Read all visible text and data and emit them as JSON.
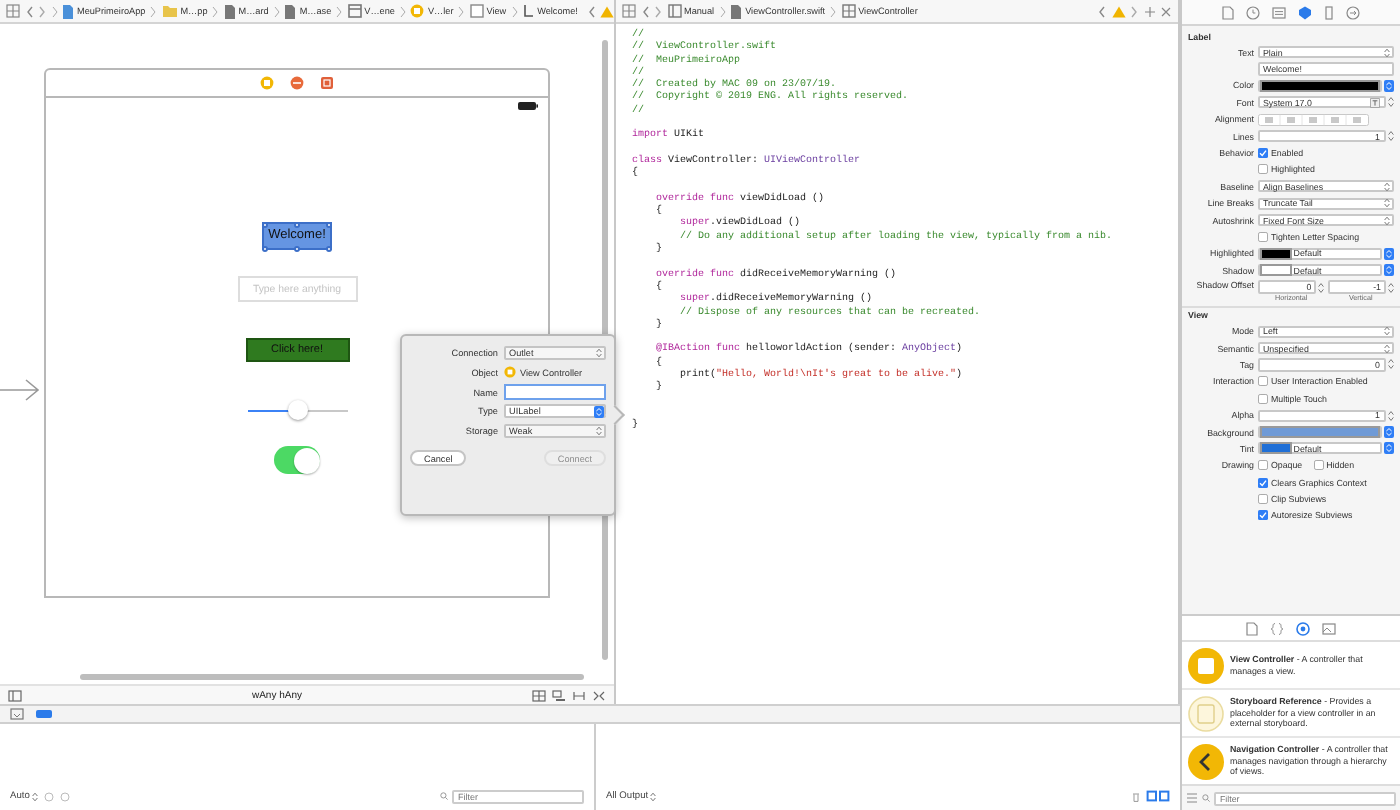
{
  "interface_builder": {
    "breadcrumb": [
      {
        "kind": "project",
        "text": "MeuPrimeiroApp"
      },
      {
        "kind": "folder",
        "text": "M…pp"
      },
      {
        "kind": "file",
        "text": "M…ard"
      },
      {
        "kind": "file",
        "text": "M…ase"
      },
      {
        "kind": "scene",
        "text": "V…ene"
      },
      {
        "kind": "controller",
        "text": "V…ler"
      },
      {
        "kind": "view",
        "text": "View"
      },
      {
        "kind": "label",
        "text": "Welcome!"
      }
    ],
    "canvas": {
      "label": {
        "text": "Welcome!",
        "selected": true
      },
      "text_field": {
        "placeholder": "Type here anything"
      },
      "button": {
        "label": "Click here!"
      },
      "slider": {
        "level": 0.5
      },
      "switch": {
        "on": true
      }
    },
    "size_class": "wAny hAny"
  },
  "code_editor": {
    "breadcrumb": [
      "Manual",
      "ViewController.swift",
      "ViewController"
    ],
    "lines": [
      {
        "kind": "code",
        "tokens": [
          {
            "kind": "comment",
            "text": "//"
          }
        ]
      },
      {
        "kind": "code",
        "tokens": [
          {
            "kind": "comment",
            "text": "//  ViewController.swift"
          }
        ]
      },
      {
        "kind": "code",
        "tokens": [
          {
            "kind": "comment",
            "text": "//  MeuPrimeiroApp"
          }
        ]
      },
      {
        "kind": "code",
        "tokens": [
          {
            "kind": "comment",
            "text": "//"
          }
        ]
      },
      {
        "kind": "code",
        "tokens": [
          {
            "kind": "comment",
            "text": "//  Created by MAC 09 on 23/07/19."
          }
        ]
      },
      {
        "kind": "code",
        "tokens": [
          {
            "kind": "comment",
            "text": "//  Copyright © 2019 ENG. All rights reserved."
          }
        ]
      },
      {
        "kind": "code",
        "tokens": [
          {
            "kind": "comment",
            "text": "//"
          }
        ]
      },
      {
        "kind": "blank"
      },
      {
        "kind": "code",
        "tokens": [
          {
            "kind": "keyword",
            "text": "import"
          },
          {
            "kind": "plain",
            "text": " UIKit"
          }
        ]
      },
      {
        "kind": "blank"
      },
      {
        "kind": "code",
        "tokens": [
          {
            "kind": "keyword",
            "text": "class"
          },
          {
            "kind": "plain",
            "text": " ViewController: "
          },
          {
            "kind": "type",
            "text": "UIViewController"
          }
        ]
      },
      {
        "kind": "code",
        "tokens": [
          {
            "kind": "plain",
            "text": "{"
          }
        ]
      },
      {
        "kind": "blank"
      },
      {
        "kind": "code",
        "tokens": [
          {
            "kind": "keyword",
            "text": "    override func"
          },
          {
            "kind": "plain",
            "text": " viewDidLoad ()"
          }
        ]
      },
      {
        "kind": "code",
        "tokens": [
          {
            "kind": "plain",
            "text": "    {"
          }
        ]
      },
      {
        "kind": "code",
        "tokens": [
          {
            "kind": "keyword",
            "text": "        super"
          },
          {
            "kind": "plain",
            "text": ".viewDidLoad ()"
          }
        ]
      },
      {
        "kind": "code",
        "tokens": [
          {
            "kind": "comment",
            "text": "        // Do any additional setup after loading the view, typically from a nib."
          }
        ]
      },
      {
        "kind": "code",
        "tokens": [
          {
            "kind": "plain",
            "text": "    }"
          }
        ]
      },
      {
        "kind": "blank"
      },
      {
        "kind": "code",
        "tokens": [
          {
            "kind": "keyword",
            "text": "    override func"
          },
          {
            "kind": "plain",
            "text": " didReceiveMemoryWarning ()"
          }
        ]
      },
      {
        "kind": "code",
        "tokens": [
          {
            "kind": "plain",
            "text": "    {"
          }
        ]
      },
      {
        "kind": "code",
        "tokens": [
          {
            "kind": "keyword",
            "text": "        super"
          },
          {
            "kind": "plain",
            "text": ".didReceiveMemoryWarning ()"
          }
        ]
      },
      {
        "kind": "code",
        "tokens": [
          {
            "kind": "comment",
            "text": "        // Dispose of any resources that can be recreated."
          }
        ]
      },
      {
        "kind": "code",
        "tokens": [
          {
            "kind": "plain",
            "text": "    }"
          }
        ]
      },
      {
        "kind": "blank"
      },
      {
        "kind": "code",
        "tokens": [
          {
            "kind": "keyword",
            "text": "    @IBAction func"
          },
          {
            "kind": "plain",
            "text": " helloworldAction (sender: "
          },
          {
            "kind": "type",
            "text": "AnyObject"
          },
          {
            "kind": "plain",
            "text": ")"
          }
        ]
      },
      {
        "kind": "code",
        "tokens": [
          {
            "kind": "plain",
            "text": "    {"
          }
        ]
      },
      {
        "kind": "code",
        "tokens": [
          {
            "kind": "plain",
            "text": "        print("
          },
          {
            "kind": "string",
            "text": "\"Hello, World!\\nIt's great to be alive.\""
          },
          {
            "kind": "plain",
            "text": ")"
          }
        ]
      },
      {
        "kind": "code",
        "tokens": [
          {
            "kind": "plain",
            "text": "    }"
          }
        ]
      },
      {
        "kind": "blank"
      },
      {
        "kind": "blank"
      },
      {
        "kind": "code",
        "tokens": [
          {
            "kind": "plain",
            "text": "}"
          }
        ]
      }
    ]
  },
  "connection_popover": {
    "rows": [
      {
        "kind": "select",
        "label": "Connection",
        "value": "Outlet"
      },
      {
        "kind": "object",
        "label": "Object",
        "value": "View Controller"
      },
      {
        "kind": "input",
        "label": "Name",
        "focused": true
      },
      {
        "kind": "combo",
        "label": "Type",
        "value": "UILabel"
      },
      {
        "kind": "select",
        "label": "Storage",
        "value": "Weak"
      }
    ],
    "buttons": [
      {
        "label": "Cancel",
        "disabled": false
      },
      {
        "label": "Connect",
        "disabled": true
      }
    ]
  },
  "debug_area": {
    "variables_scope": "Auto",
    "filter_placeholder": "Filter",
    "console_scope": "All Output"
  },
  "inspector": {
    "tabs": [
      {
        "kind": "file",
        "selected": false
      },
      {
        "kind": "help",
        "selected": false
      },
      {
        "kind": "identity",
        "selected": false
      },
      {
        "kind": "attributes",
        "selected": true
      },
      {
        "kind": "size",
        "selected": false
      },
      {
        "kind": "connections",
        "selected": false
      }
    ],
    "sections": [
      {
        "title": "Label",
        "rows": [
          {
            "kind": "select",
            "label": "Text",
            "value": "Plain"
          },
          {
            "kind": "field",
            "value": "Welcome!"
          },
          {
            "kind": "color",
            "label": "Color",
            "color": "#000000"
          },
          {
            "kind": "font",
            "label": "Font",
            "value": "System 17.0"
          },
          {
            "kind": "segmented",
            "label": "Alignment"
          },
          {
            "kind": "stepper",
            "label": "Lines",
            "value": "1"
          },
          {
            "kind": "checks",
            "label": "Behavior",
            "items": [
              {
                "label": "Enabled",
                "checked": true
              }
            ]
          },
          {
            "kind": "checks",
            "items": [
              {
                "label": "Highlighted",
                "checked": false
              }
            ]
          },
          {
            "kind": "select",
            "label": "Baseline",
            "value": "Align Baselines"
          },
          {
            "kind": "select",
            "label": "Line Breaks",
            "value": "Truncate Tail"
          },
          {
            "kind": "select",
            "label": "Autoshrink",
            "value": "Fixed Font Size"
          },
          {
            "kind": "checks",
            "items": [
              {
                "label": "Tighten Letter Spacing",
                "checked": false
              }
            ]
          },
          {
            "kind": "color",
            "label": "Highlighted",
            "color": "#000000",
            "value": "Default"
          },
          {
            "kind": "color",
            "label": "Shadow",
            "color": "#ffffff",
            "value": "Default"
          },
          {
            "kind": "offset",
            "label": "Shadow Offset",
            "fields": [
              {
                "value": "0",
                "caption": "Horizontal"
              },
              {
                "value": "-1",
                "caption": "Vertical"
              }
            ]
          }
        ]
      },
      {
        "title": "View",
        "rows": [
          {
            "kind": "select",
            "label": "Mode",
            "value": "Left"
          },
          {
            "kind": "select",
            "label": "Semantic",
            "value": "Unspecified"
          },
          {
            "kind": "stepper",
            "label": "Tag",
            "value": "0"
          },
          {
            "kind": "checks",
            "label": "Interaction",
            "items": [
              {
                "label": "User Interaction Enabled",
                "checked": false
              }
            ]
          },
          {
            "kind": "checks",
            "items": [
              {
                "label": "Multiple Touch",
                "checked": false
              }
            ]
          },
          {
            "kind": "stepper",
            "label": "Alpha",
            "value": "1"
          },
          {
            "kind": "color",
            "label": "Background",
            "color": "#6f9ad6"
          },
          {
            "kind": "color",
            "label": "Tint",
            "color": "#1f6fd6",
            "value": "Default"
          },
          {
            "kind": "checks",
            "label": "Drawing",
            "items": [
              {
                "label": "Opaque",
                "checked": false
              },
              {
                "label": "Hidden",
                "checked": false
              }
            ]
          },
          {
            "kind": "checks",
            "items": [
              {
                "label": "Clears Graphics Context",
                "checked": true
              }
            ]
          },
          {
            "kind": "checks",
            "items": [
              {
                "label": "Clip Subviews",
                "checked": false
              }
            ]
          },
          {
            "kind": "checks",
            "items": [
              {
                "label": "Autoresize Subviews",
                "checked": true
              }
            ]
          }
        ]
      }
    ]
  },
  "library": {
    "tabs": [
      {
        "kind": "file",
        "selected": false
      },
      {
        "kind": "braces",
        "selected": false
      },
      {
        "kind": "object",
        "selected": true
      },
      {
        "kind": "media",
        "selected": false
      }
    ],
    "items": [
      {
        "kind": "view-controller",
        "text": "**View Controller** - A controller that manages a view."
      },
      {
        "kind": "storyboard-reference",
        "text": "**Storyboard Reference** - Provides a placeholder for a view controller in an external storyboard."
      },
      {
        "kind": "navigation-controller",
        "text": "**Navigation Controller** - A controller that manages navigation through a hierarchy of views."
      }
    ],
    "filter_placeholder": "Filter"
  }
}
